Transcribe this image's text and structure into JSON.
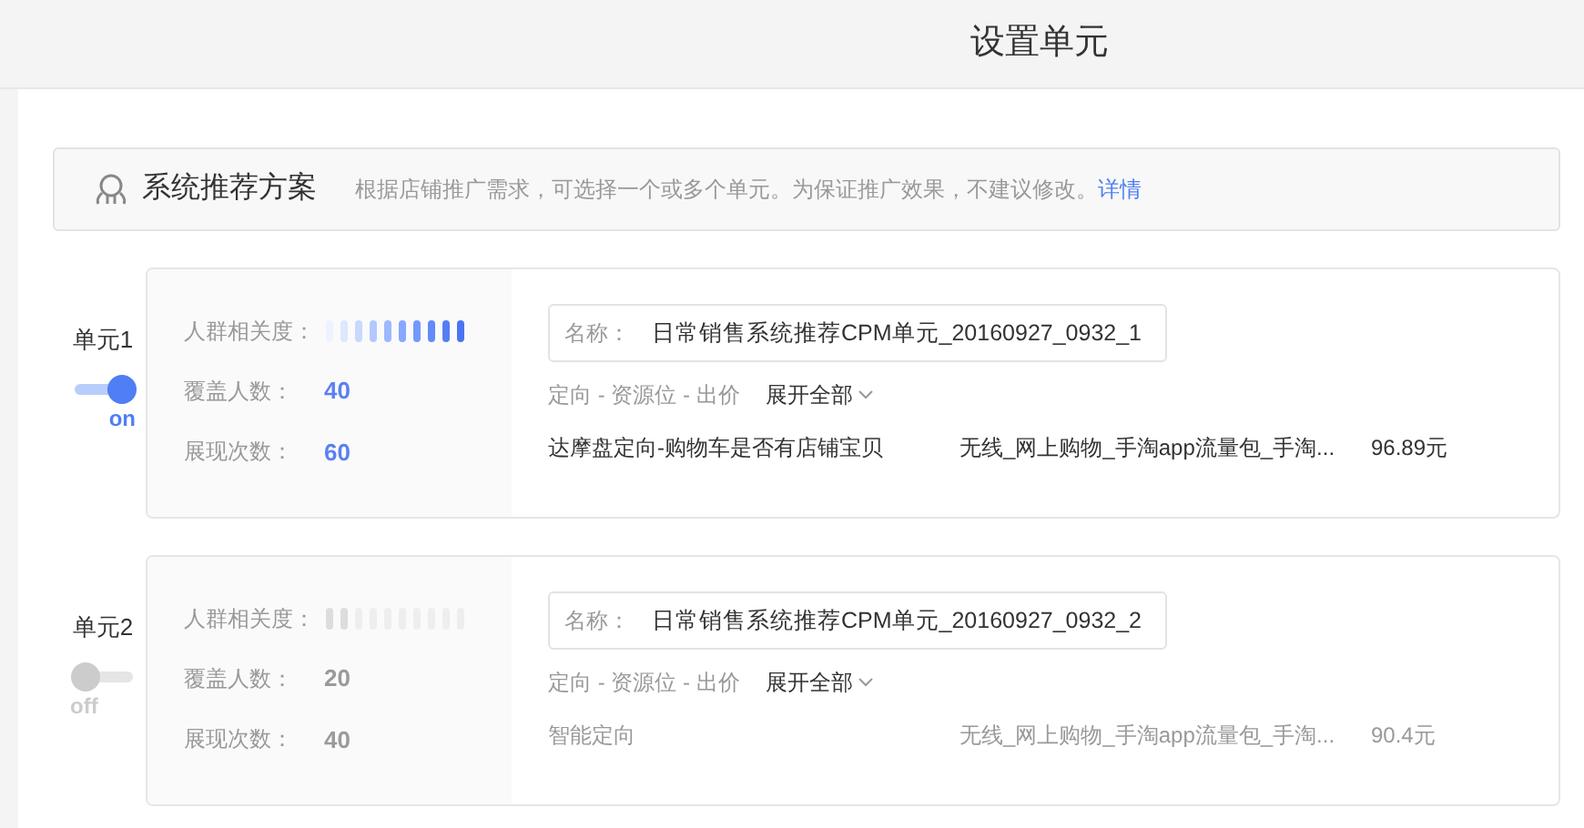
{
  "header": {
    "title": "设置单元"
  },
  "banner": {
    "title": "系统推荐方案",
    "description": "根据店铺推广需求，可选择一个或多个单元。为保证推广效果，不建议修改。",
    "link": "详情"
  },
  "units": [
    {
      "label": "单元1",
      "on": true,
      "switch_text": "on",
      "relevance_label": "人群相关度：",
      "coverage_label": "覆盖人数：",
      "coverage": "40",
      "impressions_label": "展现次数：",
      "impressions": "60",
      "name_label": "名称：",
      "name": "日常销售系统推荐CPM单元_20160927_0932_1",
      "section_label": "定向 - 资源位 - 出价",
      "expand": "展开全部",
      "targeting": "达摩盘定向-购物车是否有店铺宝贝",
      "resource": "无线_网上购物_手淘app流量包_手淘...",
      "price": "96.89元"
    },
    {
      "label": "单元2",
      "on": false,
      "switch_text": "off",
      "relevance_label": "人群相关度：",
      "coverage_label": "覆盖人数：",
      "coverage": "20",
      "impressions_label": "展现次数：",
      "impressions": "40",
      "name_label": "名称：",
      "name": "日常销售系统推荐CPM单元_20160927_0932_2",
      "section_label": "定向 - 资源位 - 出价",
      "expand": "展开全部",
      "targeting": "智能定向",
      "resource": "无线_网上购物_手淘app流量包_手淘...",
      "price": "90.4元"
    }
  ]
}
